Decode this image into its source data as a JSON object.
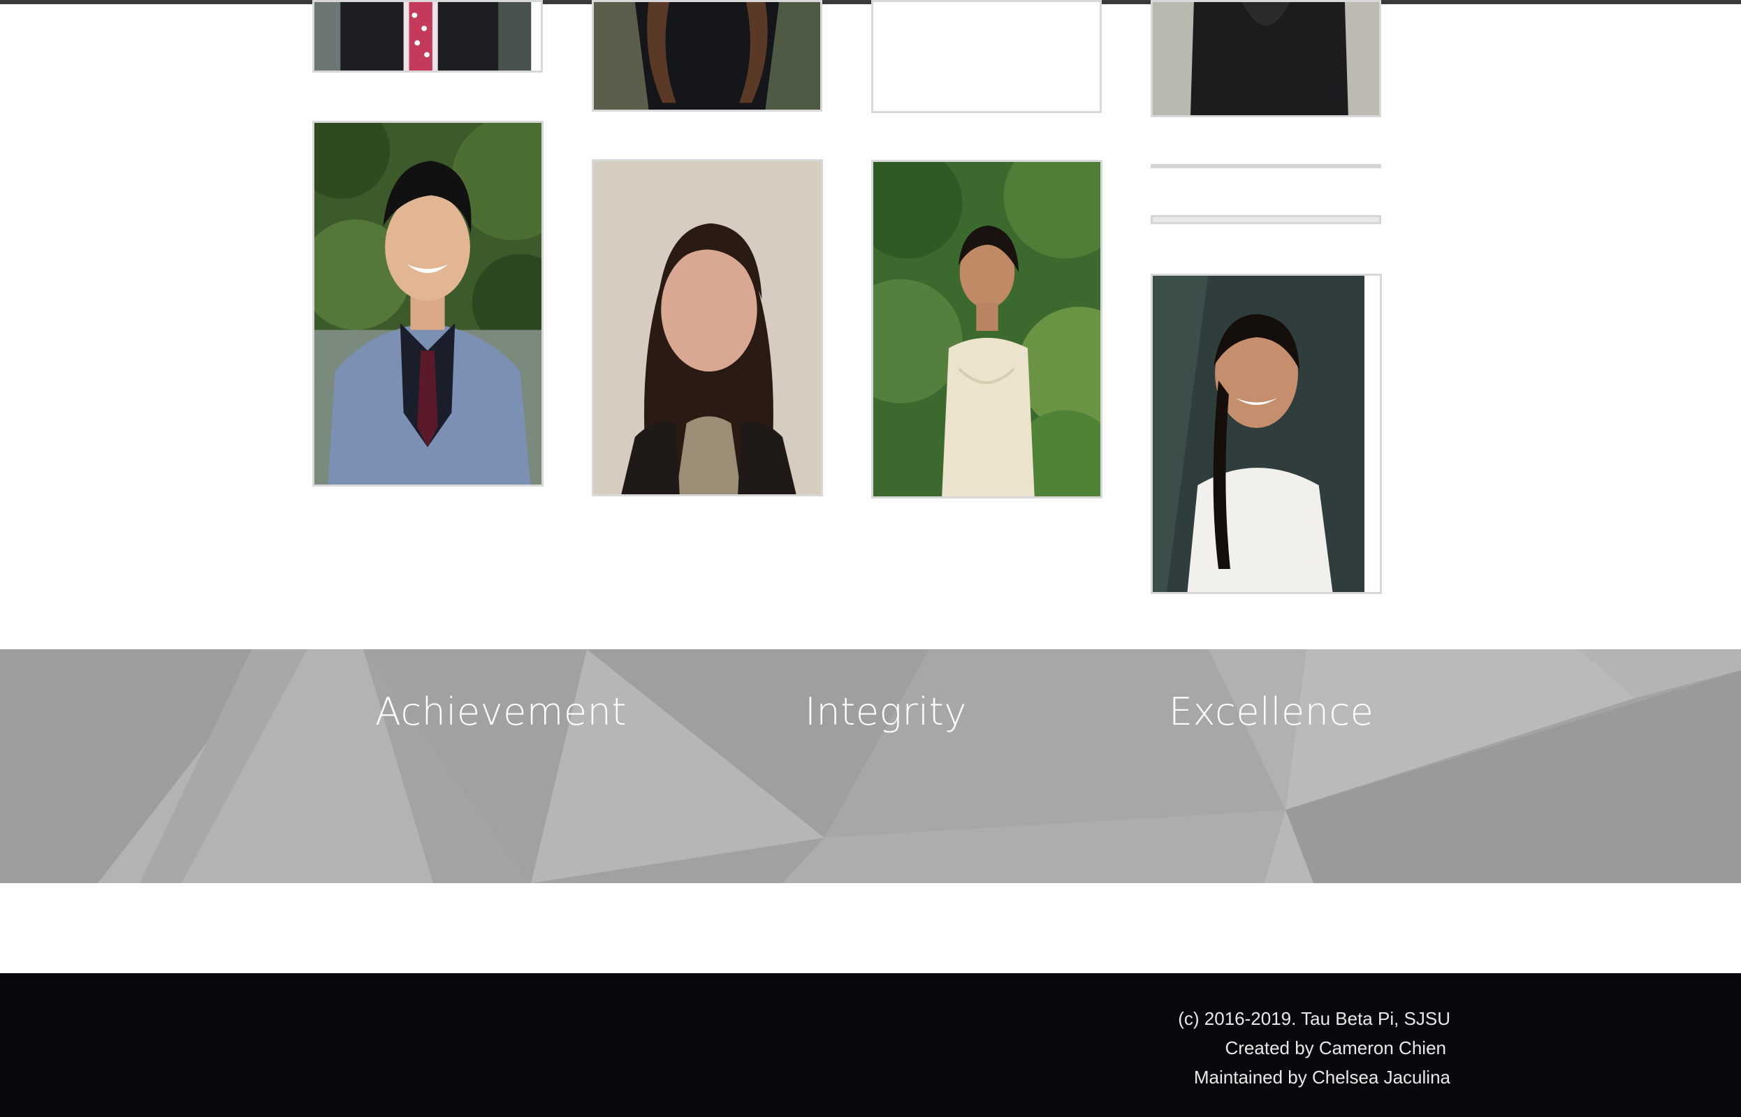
{
  "values": {
    "achievement": "Achievement",
    "integrity": "Integrity",
    "excellence": "Excellence"
  },
  "footer": {
    "copyright": "(c) 2016-2019. Tau Beta Pi, SJSU",
    "created_by": "Created by Cameron Chien",
    "maintained_by": "Maintained by Chelsea Jaculina"
  },
  "colors": {
    "values_band": "#a3a3a3",
    "footer_bg": "#07090c",
    "card_border": "#d8d8d8"
  },
  "icons": []
}
